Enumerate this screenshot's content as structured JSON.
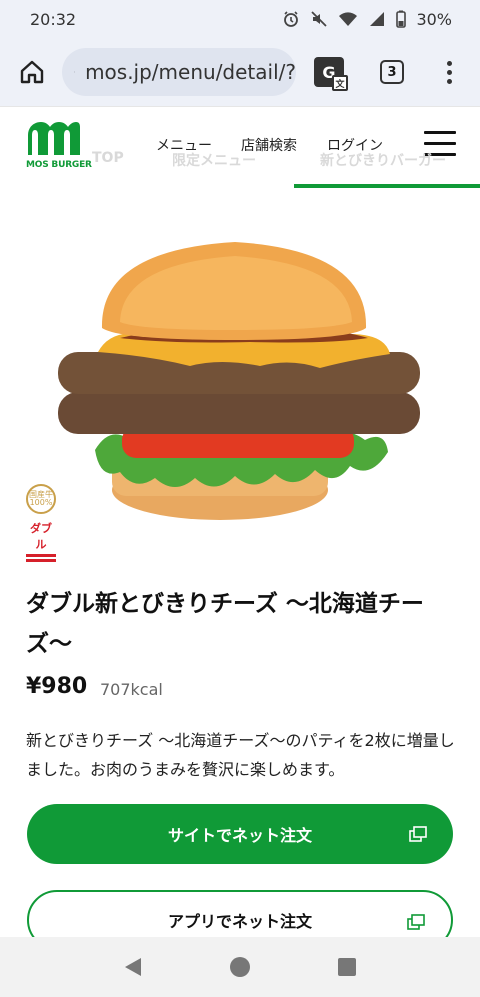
{
  "status_bar": {
    "time": "20:32",
    "battery": "30%"
  },
  "browser": {
    "url": "mos.jp/menu/detail/?",
    "tab_count": "3"
  },
  "header": {
    "logo_text": "MOS BURGER",
    "nav": {
      "menu": "メニュー",
      "store_search": "店舗検索",
      "login": "ログイン"
    },
    "subtabs": {
      "top": "TOP",
      "limited": "限定メニュー",
      "new_tobikiri": "新とびきりバーガー"
    }
  },
  "badges": {
    "domestic_top": "国産牛",
    "domestic_bottom": "100%",
    "double": "ダブル"
  },
  "product": {
    "title": "ダブル新とびきりチーズ 〜北海道チーズ〜",
    "price": "¥980",
    "kcal": "707kcal",
    "description": "新とびきりチーズ 〜北海道チーズ〜のパティを2枚に増量しました。お肉のうまみを贅沢に楽しめます。"
  },
  "buttons": {
    "site_order": "サイトでネット注文",
    "app_order": "アプリでネット注文"
  },
  "colors": {
    "brand_green": "#109a37"
  }
}
